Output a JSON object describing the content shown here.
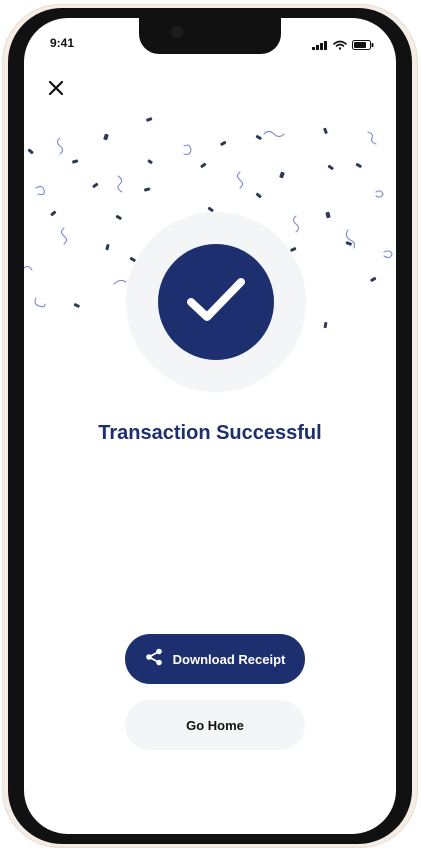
{
  "status_bar": {
    "time": "9:41",
    "signal_icon": "signal-bars-icon",
    "wifi_icon": "wifi-icon",
    "battery_icon": "battery-icon"
  },
  "header": {
    "close_icon": "close-icon"
  },
  "main": {
    "success_icon": "check-icon",
    "title": "Transaction Successful"
  },
  "actions": {
    "download_label": "Download Receipt",
    "download_icon": "share-icon",
    "home_label": "Go Home"
  },
  "colors": {
    "accent": "#1d2f6f",
    "confetti_dark": "#2b3a55",
    "confetti_light": "#7b8ac8",
    "button_secondary_bg": "#f4f5f7"
  }
}
